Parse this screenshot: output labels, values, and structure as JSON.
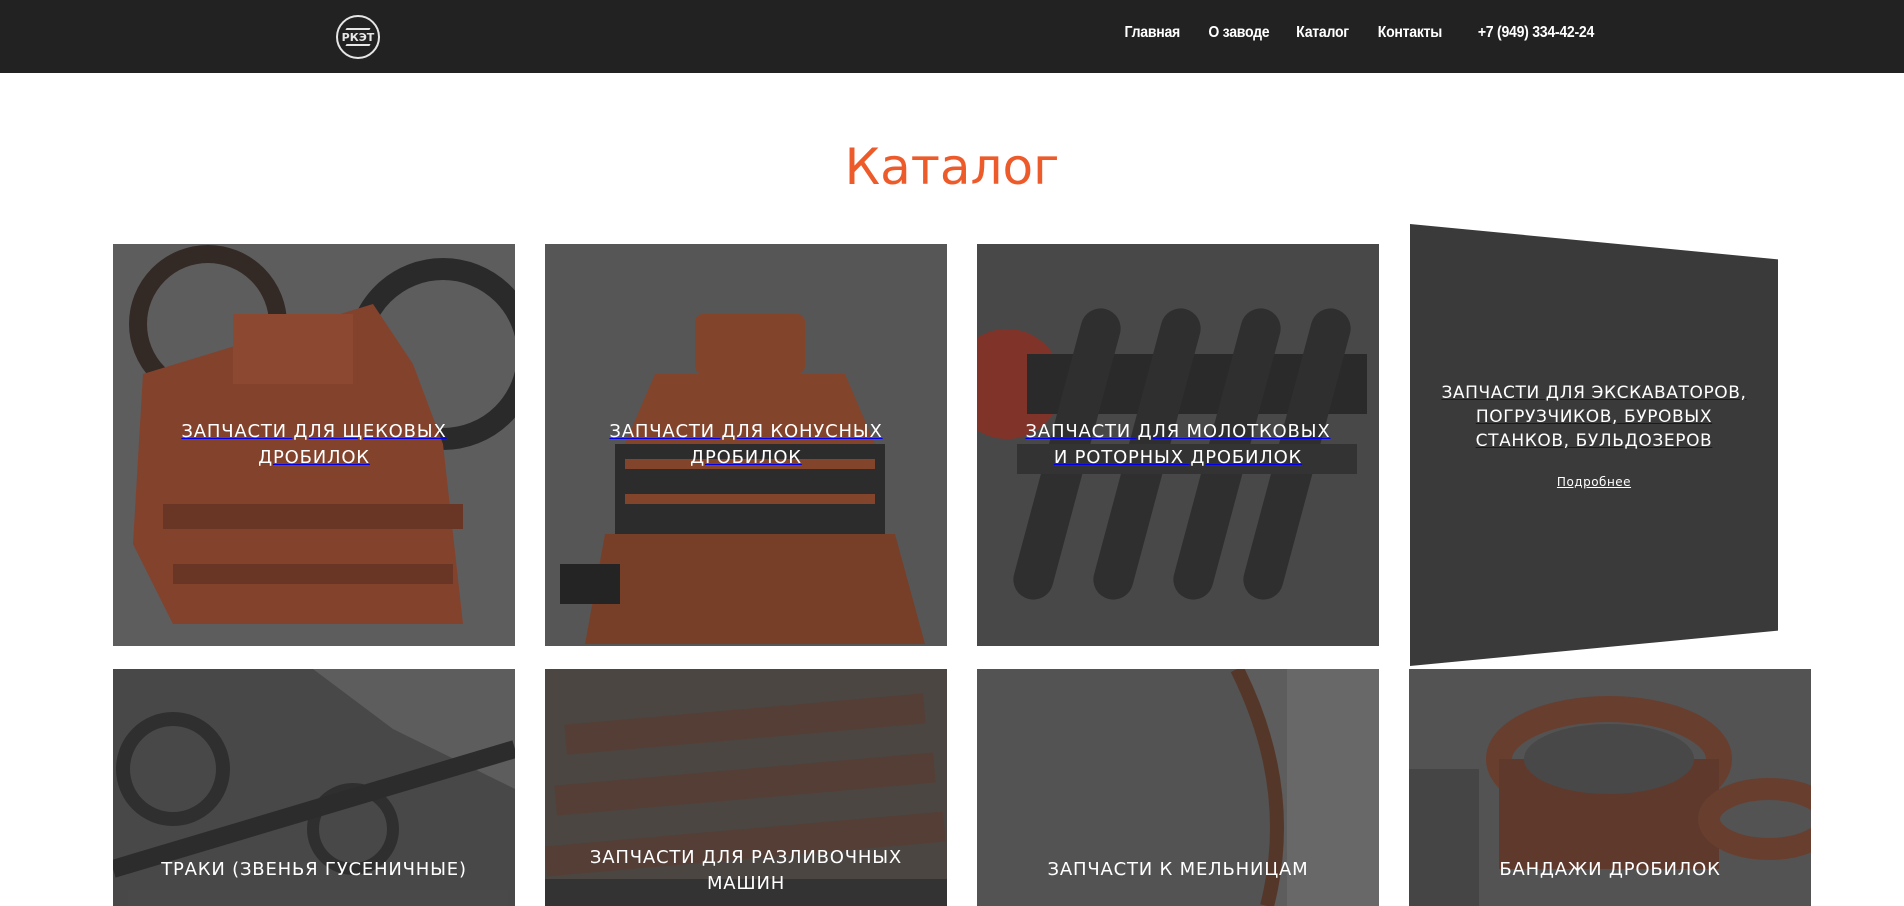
{
  "header": {
    "logo_text": "РКЭТ",
    "nav": [
      "Главная",
      "О заводе",
      "Каталог",
      "Контакты",
      "+7 (949) 334-42-24"
    ]
  },
  "page": {
    "title": "Каталог"
  },
  "catalog": {
    "items": [
      {
        "label": "Запчасти для щековых дробилок"
      },
      {
        "label": "Запчасти для конусных дробилок"
      },
      {
        "label": "Запчасти для молотковых и роторных дробилок"
      },
      {
        "label": "Запчасти для экскаваторов, погрузчиков, буровых станков, бульдозеров",
        "more": "Подробнее"
      },
      {
        "label": "Траки (звенья гусеничные)"
      },
      {
        "label": "Запчасти для разливочных машин"
      },
      {
        "label": "Запчасти к мельницам"
      },
      {
        "label": "Бандажи дробилок"
      }
    ]
  },
  "colors": {
    "accent": "#ee5b2b",
    "header_bg": "#222222"
  }
}
